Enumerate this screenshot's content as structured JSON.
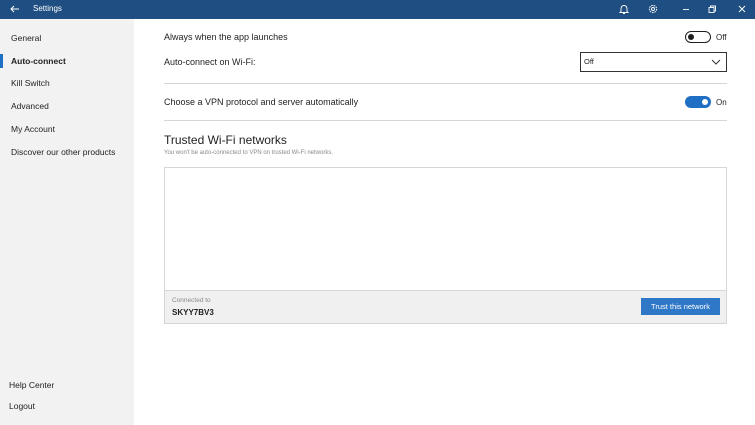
{
  "window": {
    "title": "Settings"
  },
  "sidebar": {
    "items": [
      {
        "label": "General"
      },
      {
        "label": "Auto-connect"
      },
      {
        "label": "Kill Switch"
      },
      {
        "label": "Advanced"
      },
      {
        "label": "My Account"
      },
      {
        "label": "Discover our other products"
      }
    ],
    "active": "Auto-connect",
    "bottom": [
      {
        "label": "Help Center"
      },
      {
        "label": "Logout"
      }
    ]
  },
  "main": {
    "app_launch": {
      "label": "Always when the app launches",
      "state": "Off"
    },
    "wifi": {
      "label": "Auto-connect on Wi-Fi:",
      "selected": "Off"
    },
    "protocol": {
      "label": "Choose a VPN protocol and server automatically",
      "state": "On"
    },
    "trusted": {
      "title": "Trusted Wi-Fi networks",
      "subtitle": "You won't be auto-connected to VPN on trusted Wi-Fi networks.",
      "connected_label": "Connected to",
      "connected_name": "SKYY7BV3",
      "trust_button": "Trust this network"
    }
  },
  "colors": {
    "titlebar": "#1f4f82",
    "accent": "#1f6fc5",
    "button": "#2f78c8",
    "sidebar": "#f2f2f2"
  },
  "icons": [
    "back-arrow-icon",
    "bell-icon",
    "gear-icon",
    "restore-icon",
    "close-icon",
    "chevron-down-icon"
  ]
}
